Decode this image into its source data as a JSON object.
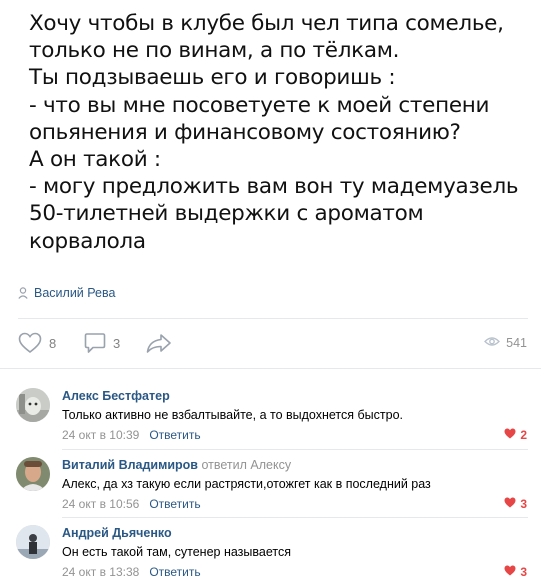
{
  "post": {
    "lines": [
      "Хочу чтобы в клубе был чел типа сомелье,",
      "только не по винам, а по тёлкам.",
      "Ты подзываешь его и говоришь :",
      "- что вы мне посоветуете к моей степени",
      "опьянения и финансовому состоянию?",
      "А он такой :",
      "- могу предложить вам вон ту мадемуазель",
      "50-тилетней выдержки с ароматом",
      "корвалола"
    ],
    "author": "Василий Рева",
    "author_icon": "person-icon"
  },
  "actions": {
    "likes": "8",
    "comments": "3",
    "views": "541",
    "like_icon": "heart-outline-icon",
    "comment_icon": "speech-bubble-icon",
    "share_icon": "share-arrow-icon",
    "views_icon": "eye-icon"
  },
  "colors": {
    "link": "#2a5885",
    "muted": "#939393",
    "like_red": "#e64646"
  },
  "comments": [
    {
      "name": "Алекс Бестфатер",
      "reply_to": "",
      "text": "Только активно не взбалтывайте, а то выдохнется быстро.",
      "date": "24 окт в 10:39",
      "reply_label": "Ответить",
      "likes": "2"
    },
    {
      "name": "Виталий Владимиров",
      "reply_to": "ответил Алексу",
      "text": "Алекс, да хз такую если растрясти,отожгет как в последний раз",
      "date": "24 окт в 10:56",
      "reply_label": "Ответить",
      "likes": "3"
    },
    {
      "name": "Андрей Дьяченко",
      "reply_to": "",
      "text": "Он есть такой там, сутенер называется",
      "date": "24 окт в 13:38",
      "reply_label": "Ответить",
      "likes": "3"
    }
  ]
}
